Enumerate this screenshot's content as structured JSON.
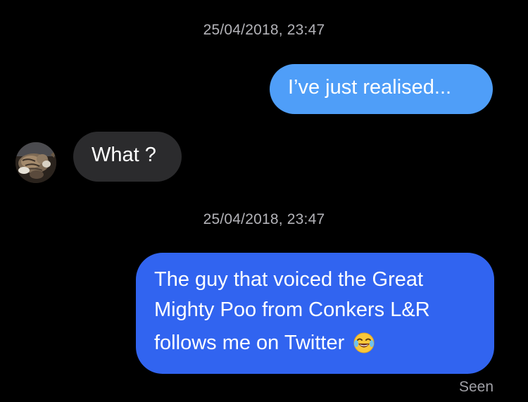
{
  "conversation": {
    "timestamps": [
      "25/04/2018, 23:47",
      "25/04/2018, 23:47"
    ],
    "messages": [
      {
        "sender": "me",
        "text": "I’ve just realised..."
      },
      {
        "sender": "other",
        "text": "What ?"
      },
      {
        "sender": "me",
        "lines": [
          "The guy that voiced the Great",
          "Mighty Poo from Conkers L&R",
          "follows me on Twitter"
        ],
        "emoji": "face-with-tears-of-joy-icon"
      }
    ],
    "status": "Seen"
  },
  "colors": {
    "background": "#000000",
    "sent_bubble_light": "#4f9ef8",
    "sent_bubble_dark": "#3164f0",
    "received_bubble": "#2b2b2d",
    "timestamp_text": "#b3b3b8"
  },
  "icons": {
    "avatar": "cat-avatar-photo",
    "emoji": "face-with-tears-of-joy-icon"
  }
}
